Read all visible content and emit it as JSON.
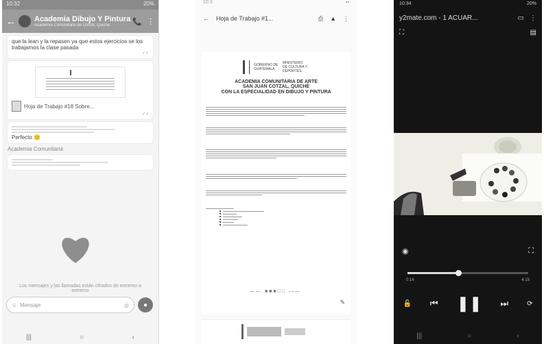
{
  "chat": {
    "status_time": "10:32",
    "status_right": "20%",
    "title": "Academia Dibujo Y Pintura",
    "subtitle": "Academia Comunitaria de Cotzal, Quiché",
    "message_text": "que la lean y la repasen ya que estos ejercicios se los trabajamos la clase pasada",
    "doc_name": "Hoja de Trabajo #18 Sobre...",
    "reply_text": "Perfecto",
    "section_label": "Academia Comunitaria",
    "input_placeholder": "Mensaje",
    "forward_note": "Los mensajes y las llamadas están cifrados de extremo a extremo"
  },
  "doc": {
    "status_time": "10:3",
    "title": "Hoja de Trabajo #1...",
    "logo_left": "GOBIERNO DE GUATEMALA",
    "logo_right": "MINISTERIO DE CULTURA Y DEPORTES",
    "heading_line1": "ACADEMIA COMUNITARIA DE ARTE",
    "heading_line2": "SAN JUAN COTZAL, QUICHÉ",
    "heading_line3": "CON LA ESPECIALIDAD EN DIBUJO Y PINTURA",
    "pager": "—— ■■■□□ ——"
  },
  "video": {
    "status_time": "10:34",
    "status_right": "20%",
    "title": "y2mate.com - 1 ACUAR...",
    "time_current": "0:14",
    "time_total": "4:15",
    "progress": 0.42,
    "colors": {
      "dark": "#141414",
      "accent": "#dddddd"
    }
  }
}
